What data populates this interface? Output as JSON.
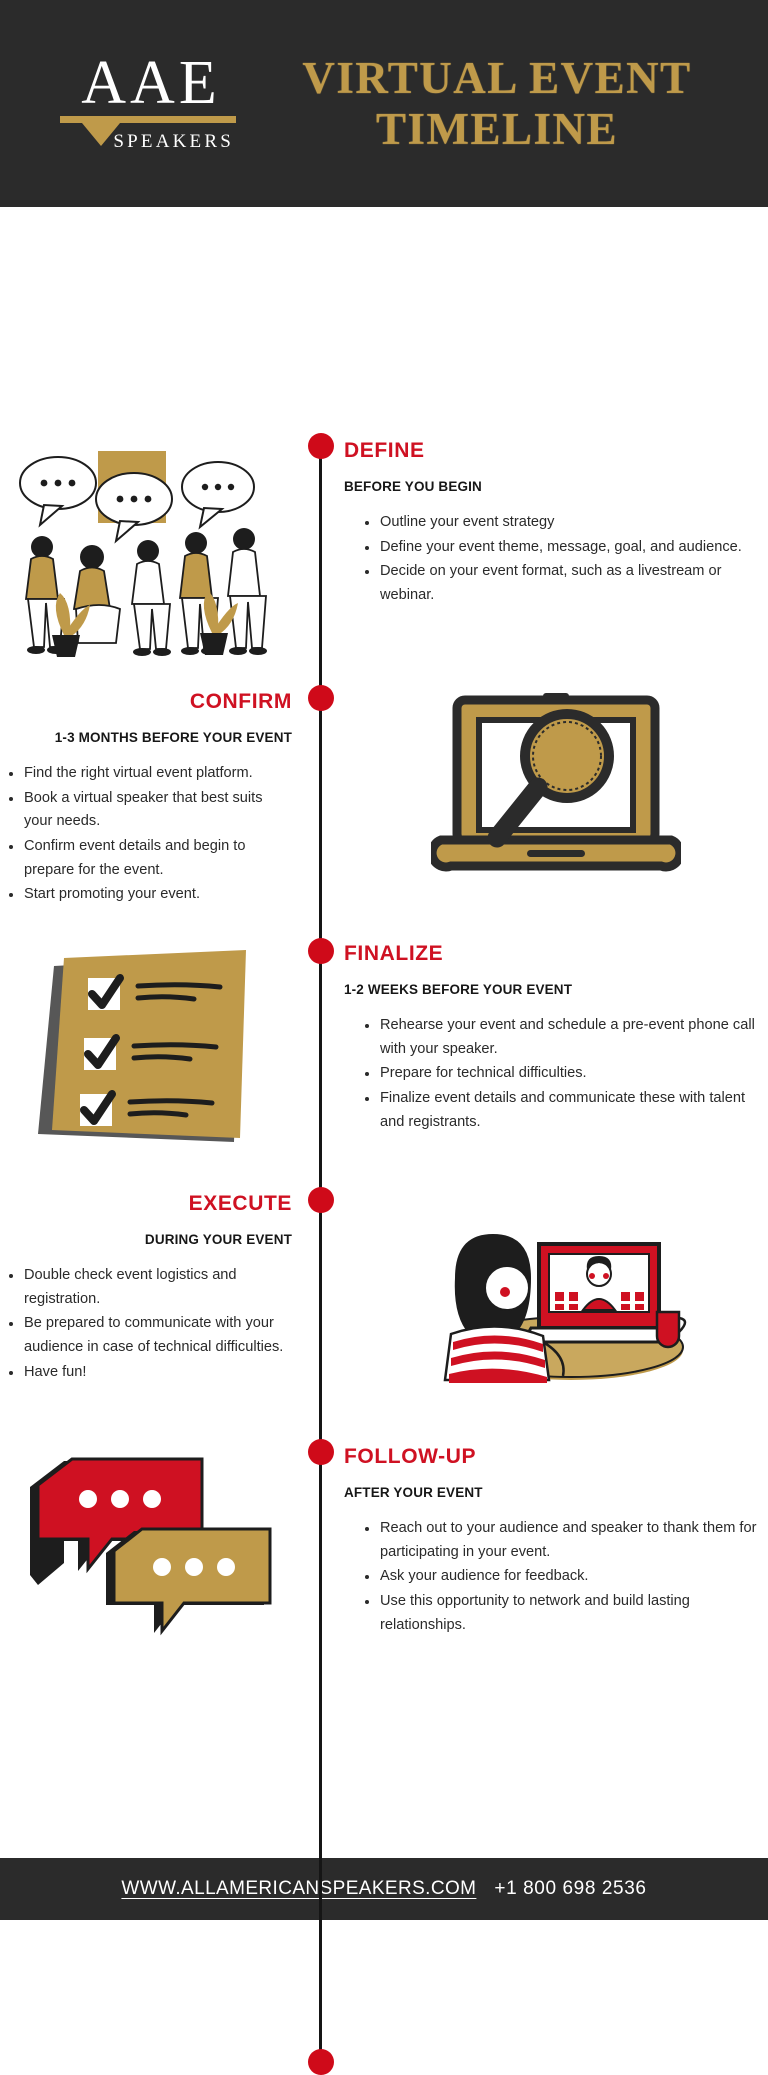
{
  "header": {
    "logo_main": "AAE",
    "logo_sub": "SPEAKERS",
    "title_line1": "VIRTUAL EVENT",
    "title_line2": "TIMELINE",
    "bg_color": "#2b2b2b",
    "gold_color": "#bf9a4a"
  },
  "theme": {
    "red": "#cf1122",
    "node_red": "#cf0a19",
    "gold": "#bf9a4a",
    "dark": "#2b2b2b"
  },
  "sections": [
    {
      "title": "DEFINE",
      "subtitle": "BEFORE YOU BEGIN",
      "side": "right",
      "illustration": "people-talking-speech-bubbles-illustration",
      "bullets": [
        "Outline your event strategy",
        "Define your event theme, message, goal, and audience.",
        "Decide on your event format, such as a livestream or webinar."
      ]
    },
    {
      "title": "CONFIRM",
      "subtitle": "1-3 MONTHS BEFORE YOUR EVENT",
      "side": "left",
      "illustration": "laptop-magnifying-glass-illustration",
      "bullets": [
        "Find the right virtual event platform.",
        "Book a virtual speaker that best suits your needs.",
        "Confirm event details and begin to prepare for the event.",
        "Start promoting your event."
      ]
    },
    {
      "title": "FINALIZE",
      "subtitle": "1-2 WEEKS BEFORE YOUR EVENT",
      "side": "right",
      "illustration": "checklist-clipboard-illustration",
      "bullets": [
        "Rehearse your event and schedule a pre-event phone call with your speaker.",
        "Prepare for technical difficulties.",
        "Finalize event details and communicate these with talent and registrants."
      ]
    },
    {
      "title": "EXECUTE",
      "subtitle": "DURING YOUR EVENT",
      "side": "left",
      "illustration": "woman-at-laptop-video-call-illustration",
      "bullets": [
        "Double check event logistics and registration.",
        "Be prepared to communicate with your audience in case of technical difficulties.",
        "Have fun!"
      ]
    },
    {
      "title": "FOLLOW-UP",
      "subtitle": "AFTER YOUR EVENT",
      "side": "right",
      "illustration": "two-speech-bubbles-illustration",
      "bullets": [
        "Reach out to your audience and speaker to thank them for participating in your event.",
        "Ask your audience for feedback.",
        "Use this opportunity to network and build lasting relationships."
      ]
    }
  ],
  "footer": {
    "url": "WWW.ALLAMERICANSPEAKERS.COM",
    "phone": "+1 800 698 2536"
  }
}
